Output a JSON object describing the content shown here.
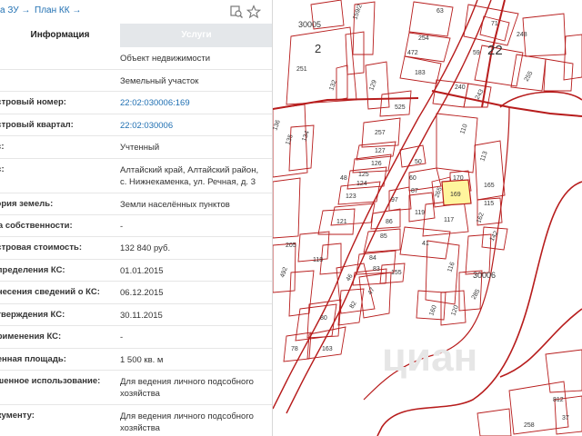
{
  "topbar": {
    "link_zu": "а ЗУ →",
    "link_plan": "План КК →"
  },
  "tabs": {
    "info": "Информация",
    "services": "Услуги"
  },
  "rows": [
    {
      "label": "",
      "value": "Объект недвижимости"
    },
    {
      "label": "",
      "value": "Земельный участок"
    },
    {
      "label": "астровый номер:",
      "value": "22:02:030006:169"
    },
    {
      "label": "астровый квартал:",
      "value": "22:02:030006"
    },
    {
      "label": "ус:",
      "value": "Учтенный"
    },
    {
      "label": "ес:",
      "value": "Алтайский край, Алтайский район, с. Нижнекаменка, ул. Речная, д. 3"
    },
    {
      "label": "тория земель:",
      "value": "Земли населённых пунктов"
    },
    {
      "label": "ма собственности:",
      "value": "-"
    },
    {
      "label": "астровая стоимость:",
      "value": "132 840 руб."
    },
    {
      "label": "определения КС:",
      "value": "01.01.2015"
    },
    {
      "label": "внесения сведений о КС:",
      "value": "06.12.2015"
    },
    {
      "label": "утверждения КС:",
      "value": "30.11.2015"
    },
    {
      "label": "применения КС:",
      "value": "-"
    },
    {
      "label": "ненная площадь:",
      "value": "1 500 кв. м"
    },
    {
      "label": "ешенное использование:",
      "value": "Для ведения личного подсобного хозяйства"
    },
    {
      "label": "окументу:",
      "value": "Для ведения личного подсобного хозяйства"
    }
  ],
  "map": {
    "parcel_labels": [
      "30005",
      "2",
      "22",
      "63",
      "159/2",
      "71",
      "248",
      "251",
      "254",
      "472",
      "183",
      "59",
      "255",
      "132",
      "129",
      "240",
      "243",
      "525",
      "110",
      "257",
      "127",
      "126",
      "50",
      "136",
      "135",
      "134",
      "60",
      "113",
      "125",
      "170",
      "48",
      "165",
      "87",
      "265",
      "169",
      "124",
      "123",
      "97",
      "119",
      "117",
      "115",
      "162",
      "121",
      "86",
      "85",
      "142",
      "41",
      "205",
      "118",
      "84",
      "83",
      "155",
      "30006",
      "492",
      "46",
      "116",
      "47",
      "82",
      "285",
      "80",
      "160",
      "120",
      "78",
      "163",
      "812",
      "258",
      "37"
    ],
    "cadastral_blocks": [
      "30005",
      "2",
      "22",
      "30006"
    ],
    "highlight_parcel": "169",
    "line_color": "#b71c1c",
    "highlight_color": "#fff59d"
  }
}
